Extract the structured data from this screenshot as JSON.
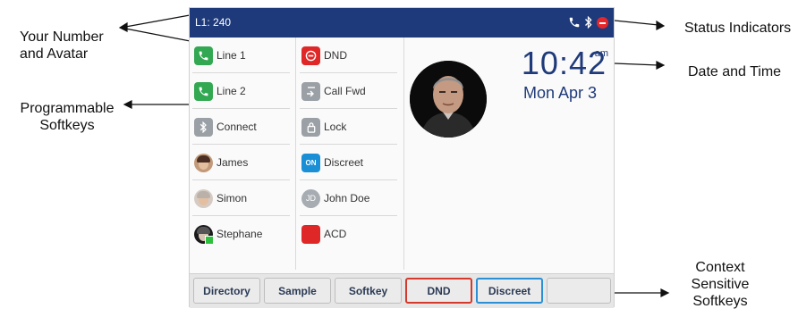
{
  "annotations": {
    "your_number": [
      "Your Number",
      "and Avatar"
    ],
    "programmable": [
      "Programmable",
      "Softkeys"
    ],
    "status": "Status Indicators",
    "datetime": "Date and Time",
    "context": [
      "Context",
      "Sensitive",
      "Softkeys"
    ]
  },
  "phone": {
    "status_bar": {
      "line": "L1: 240",
      "icons": [
        "phone-icon",
        "bluetooth-icon",
        "dnd-icon"
      ],
      "color": "#1f3a7a"
    },
    "softkeys_left": [
      {
        "label": "Line 1",
        "icon": "phone-icon"
      },
      {
        "label": "Line 2",
        "icon": "phone-icon"
      },
      {
        "label": "Connect",
        "icon": "bluetooth-icon"
      },
      {
        "label": "James",
        "icon": "avatar-icon"
      },
      {
        "label": "Simon",
        "icon": "avatar-icon"
      },
      {
        "label": "Stephane",
        "icon": "avatar-icon"
      }
    ],
    "softkeys_right": [
      {
        "label": "DND",
        "icon": "dnd-icon"
      },
      {
        "label": "Call Fwd",
        "icon": "call-forward-icon"
      },
      {
        "label": "Lock",
        "icon": "lock-icon"
      },
      {
        "label": "Discreet",
        "icon": "toggle-on-icon",
        "badge": "ON"
      },
      {
        "label": "John Doe",
        "icon": "avatar-icon",
        "initials": "JD"
      },
      {
        "label": "ACD",
        "icon": "acd-icon"
      }
    ],
    "clock": {
      "time": "10:42",
      "ampm": "am",
      "date": "Mon Apr 3"
    },
    "context_keys": [
      "Directory",
      "Sample",
      "Softkey",
      "DND",
      "Discreet",
      ""
    ],
    "colors": {
      "dnd_red": "#e02727",
      "discreet_blue": "#1a8fd6",
      "phone_green": "#33a852"
    }
  }
}
